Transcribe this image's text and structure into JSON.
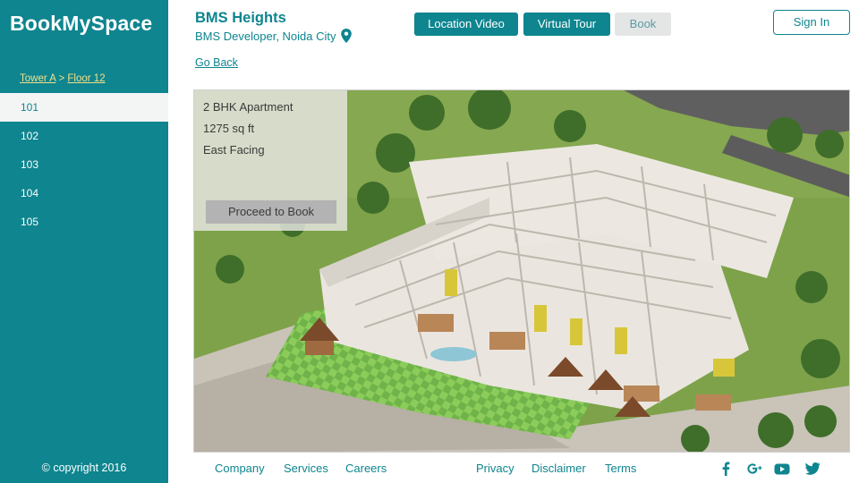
{
  "brand": {
    "logo": "BookMySpace",
    "copyright": "© copyright 2016"
  },
  "breadcrumb": {
    "tower": "Tower A",
    "separator": ">",
    "floor": "Floor 12"
  },
  "units": [
    "101",
    "102",
    "103",
    "104",
    "105"
  ],
  "selected_unit": "101",
  "header": {
    "project_title": "BMS Heights",
    "project_subtitle": "BMS Developer, Noida City",
    "buttons": {
      "location_video": "Location Video",
      "virtual_tour": "Virtual Tour",
      "book": "Book"
    },
    "sign_in": "Sign In",
    "go_back": "Go Back"
  },
  "unit_details": {
    "type": "2 BHK Apartment",
    "area": "1275 sq ft",
    "facing": "East Facing",
    "cta": "Proceed to Book"
  },
  "footer": {
    "links_left": [
      "Company",
      "Services",
      "Careers"
    ],
    "links_right": [
      "Privacy",
      "Disclaimer",
      "Terms"
    ],
    "social_icons": [
      "facebook-icon",
      "google-plus-icon",
      "youtube-icon",
      "twitter-icon"
    ]
  },
  "colors": {
    "primary": "#0e858f",
    "accent": "#f2e08a",
    "active_bg": "#f3f4f4"
  }
}
